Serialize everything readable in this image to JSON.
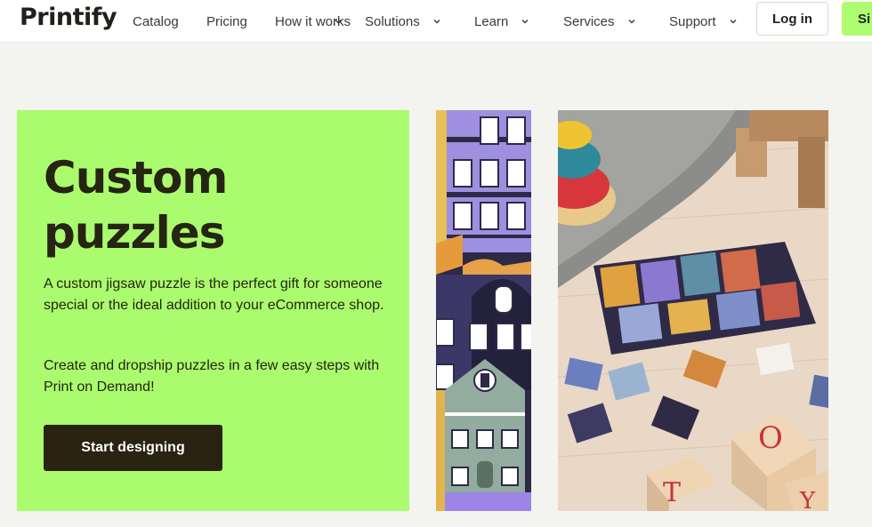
{
  "header": {
    "logo": "Printify",
    "nav": [
      {
        "label": "Catalog"
      },
      {
        "label": "Pricing"
      },
      {
        "label": "How it works"
      },
      {
        "label": "Solutions"
      },
      {
        "label": "Learn"
      },
      {
        "label": "Services"
      },
      {
        "label": "Support"
      }
    ],
    "login_label": "Log in",
    "signup_label": "Si"
  },
  "hero": {
    "title_line1": "Custom",
    "title_line2": "puzzles",
    "paragraph1": "A custom jigsaw puzzle is the perfect gift for someone special or the ideal addition to your eCommerce shop.",
    "paragraph2": "Create and dropship puzzles in a few easy steps with Print on Demand!",
    "cta_label": "Start designing"
  },
  "colors": {
    "accent": "#aafc6e",
    "dark": "#2a2312",
    "background": "#f3f3ef"
  },
  "icons": [
    "chevron-down-icon"
  ]
}
